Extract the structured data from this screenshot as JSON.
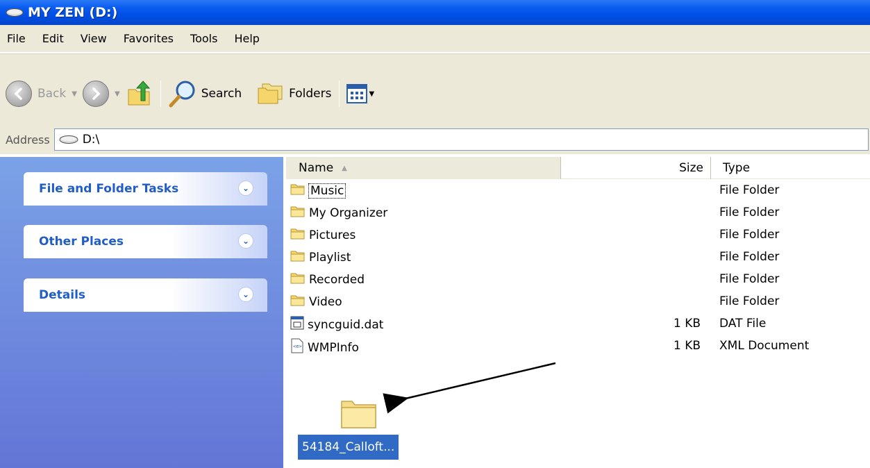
{
  "window": {
    "title": "MY ZEN (D:)"
  },
  "menu": [
    "File",
    "Edit",
    "View",
    "Favorites",
    "Tools",
    "Help"
  ],
  "toolbar": {
    "back_label": "Back",
    "search_label": "Search",
    "folders_label": "Folders"
  },
  "address": {
    "label": "Address",
    "path": "D:\\"
  },
  "tasks": [
    {
      "title": "File and Folder Tasks"
    },
    {
      "title": "Other Places"
    },
    {
      "title": "Details"
    }
  ],
  "columns": {
    "name": "Name",
    "size": "Size",
    "type": "Type"
  },
  "files": [
    {
      "name": "Music",
      "size": "",
      "type": "File Folder",
      "icon": "folder-icon"
    },
    {
      "name": "My Organizer",
      "size": "",
      "type": "File Folder",
      "icon": "folder-icon"
    },
    {
      "name": "Pictures",
      "size": "",
      "type": "File Folder",
      "icon": "folder-icon"
    },
    {
      "name": "Playlist",
      "size": "",
      "type": "File Folder",
      "icon": "folder-icon"
    },
    {
      "name": "Recorded",
      "size": "",
      "type": "File Folder",
      "icon": "folder-icon"
    },
    {
      "name": "Video",
      "size": "",
      "type": "File Folder",
      "icon": "folder-icon"
    },
    {
      "name": "syncguid.dat",
      "size": "1 KB",
      "type": "DAT File",
      "icon": "dat-file-icon"
    },
    {
      "name": "WMPInfo",
      "size": "1 KB",
      "type": "XML Document",
      "icon": "xml-file-icon"
    }
  ],
  "dragged_item": {
    "label": "54184_Calloft..."
  },
  "colors": {
    "titlebar": "#0a5cf0",
    "taskpane_top": "#7ba2e7",
    "taskpane_bottom": "#6375d6",
    "task_title": "#215dc6",
    "selection": "#316ac5"
  }
}
